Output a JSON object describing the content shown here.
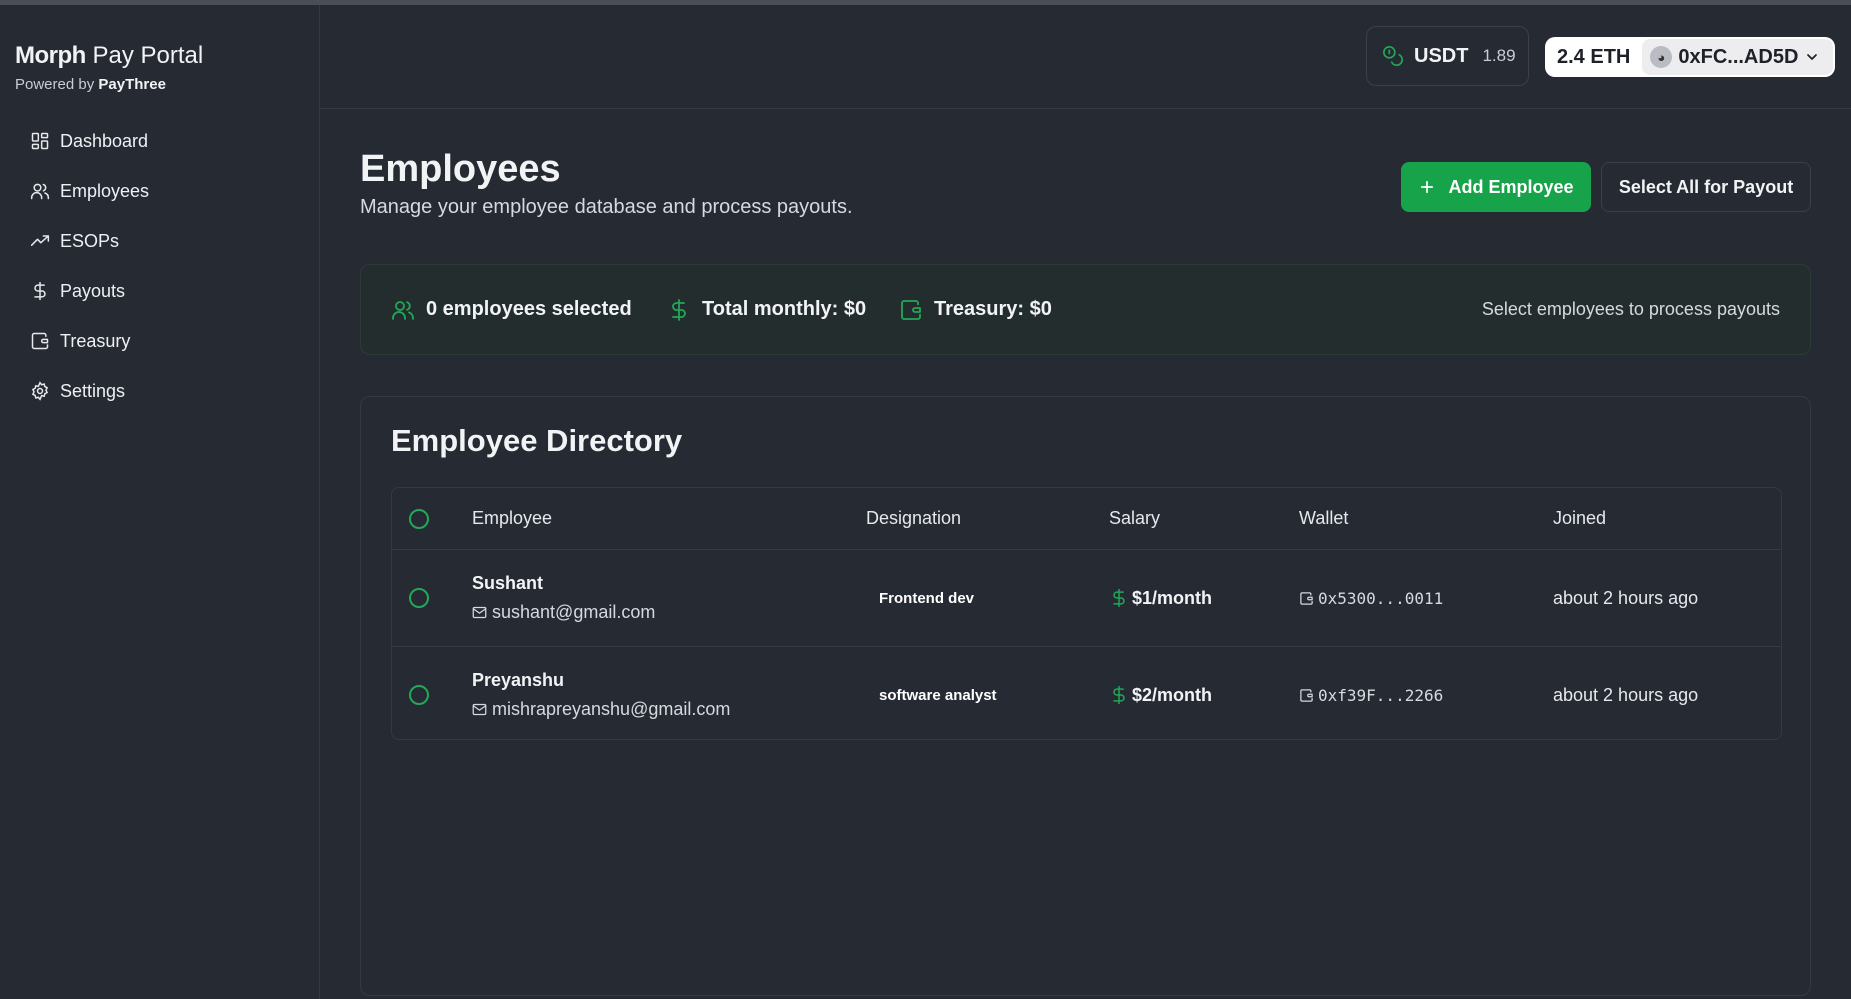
{
  "brand": {
    "name_bold": "Morph",
    "name_rest": " Pay Portal",
    "powered_prefix": "Powered by ",
    "powered_name": "PayThree"
  },
  "sidebar": {
    "items": [
      {
        "label": "Dashboard",
        "icon": "grid-icon"
      },
      {
        "label": "Employees",
        "icon": "users-icon"
      },
      {
        "label": "ESOPs",
        "icon": "trending-up-icon"
      },
      {
        "label": "Payouts",
        "icon": "dollar-icon"
      },
      {
        "label": "Treasury",
        "icon": "wallet-icon"
      },
      {
        "label": "Settings",
        "icon": "gear-icon"
      }
    ]
  },
  "topbar": {
    "token_label": "USDT",
    "token_balance": "1.89",
    "eth_balance": "2.4 ETH",
    "account": "0xFC...AD5D"
  },
  "header": {
    "title": "Employees",
    "subtitle": "Manage your employee database and process payouts.",
    "add_button": "Add Employee",
    "select_all_button": "Select All for Payout"
  },
  "summary": {
    "selected": "0 employees selected",
    "total_monthly": "Total monthly: $0",
    "treasury": "Treasury: $0",
    "hint": "Select employees to process payouts"
  },
  "directory": {
    "title": "Employee Directory",
    "columns": [
      "Employee",
      "Designation",
      "Salary",
      "Wallet",
      "Joined"
    ],
    "rows": [
      {
        "name": "Sushant",
        "email": "sushant@gmail.com",
        "designation": "Frontend dev",
        "salary": "$1/month",
        "wallet": "0x5300...0011",
        "joined": "about 2 hours ago"
      },
      {
        "name": "Preyanshu",
        "email": "mishrapreyanshu@gmail.com",
        "designation": "software analyst",
        "salary": "$2/month",
        "wallet": "0xf39F...2266",
        "joined": "about 2 hours ago"
      }
    ]
  },
  "colors": {
    "background": "#262a33",
    "accent": "#16a34a",
    "summary_bg": "#242d2d",
    "border": "#343944"
  }
}
